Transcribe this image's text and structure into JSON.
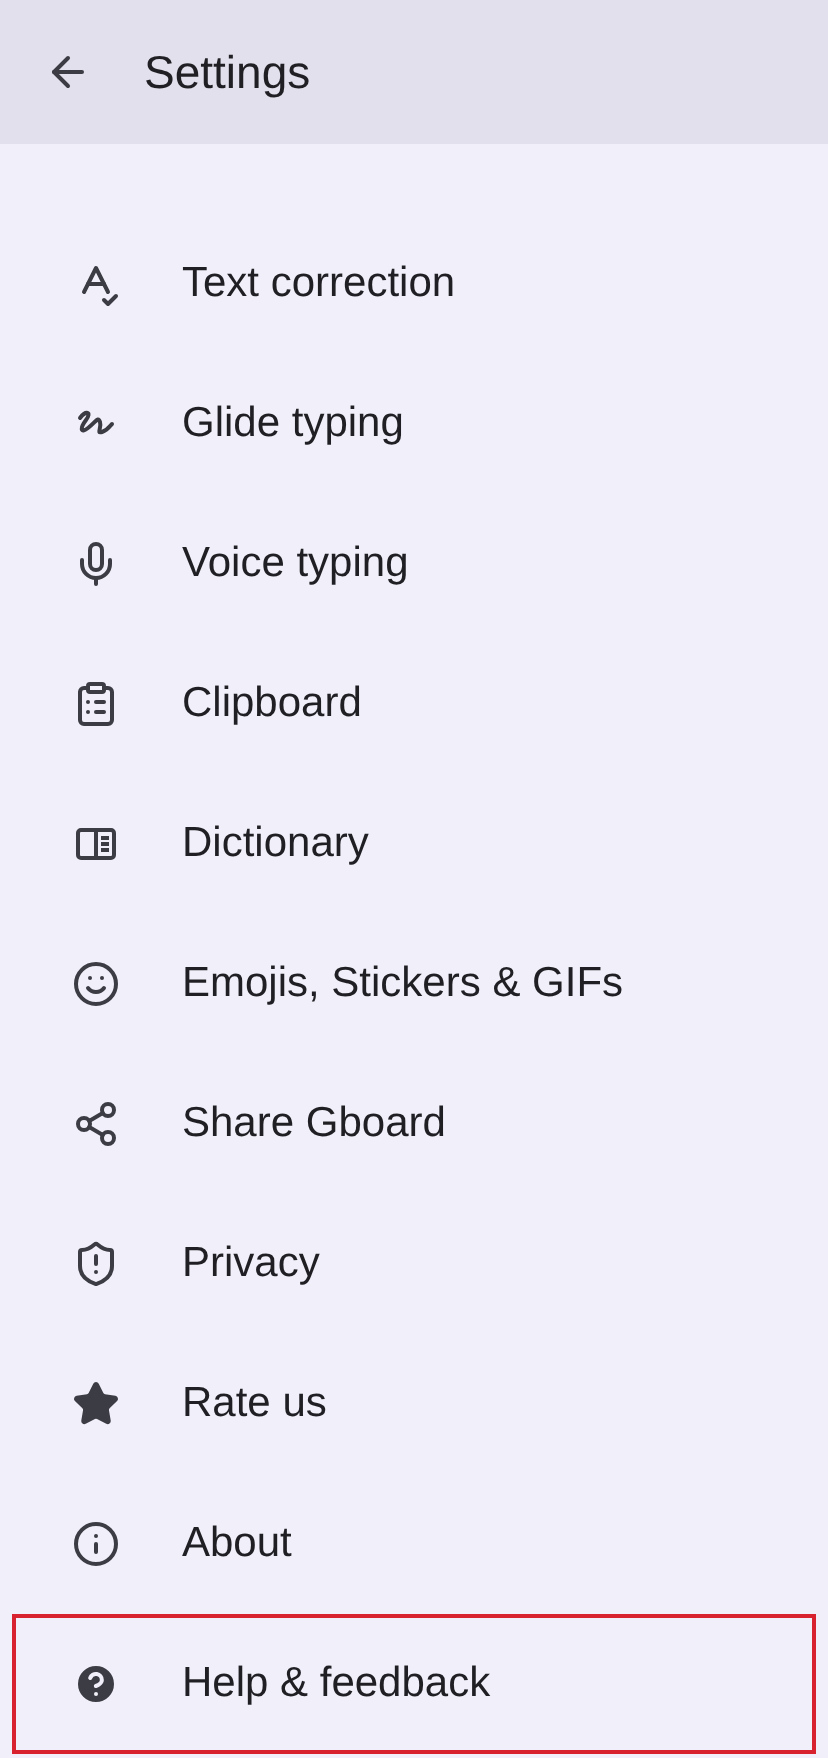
{
  "header": {
    "title": "Settings"
  },
  "items": [
    {
      "label": "Text correction",
      "highlighted": false
    },
    {
      "label": "Glide typing",
      "highlighted": false
    },
    {
      "label": "Voice typing",
      "highlighted": false
    },
    {
      "label": "Clipboard",
      "highlighted": false
    },
    {
      "label": "Dictionary",
      "highlighted": false
    },
    {
      "label": "Emojis, Stickers & GIFs",
      "highlighted": false
    },
    {
      "label": "Share Gboard",
      "highlighted": false
    },
    {
      "label": "Privacy",
      "highlighted": false
    },
    {
      "label": "Rate us",
      "highlighted": false
    },
    {
      "label": "About",
      "highlighted": false
    },
    {
      "label": "Help & feedback",
      "highlighted": true
    }
  ]
}
